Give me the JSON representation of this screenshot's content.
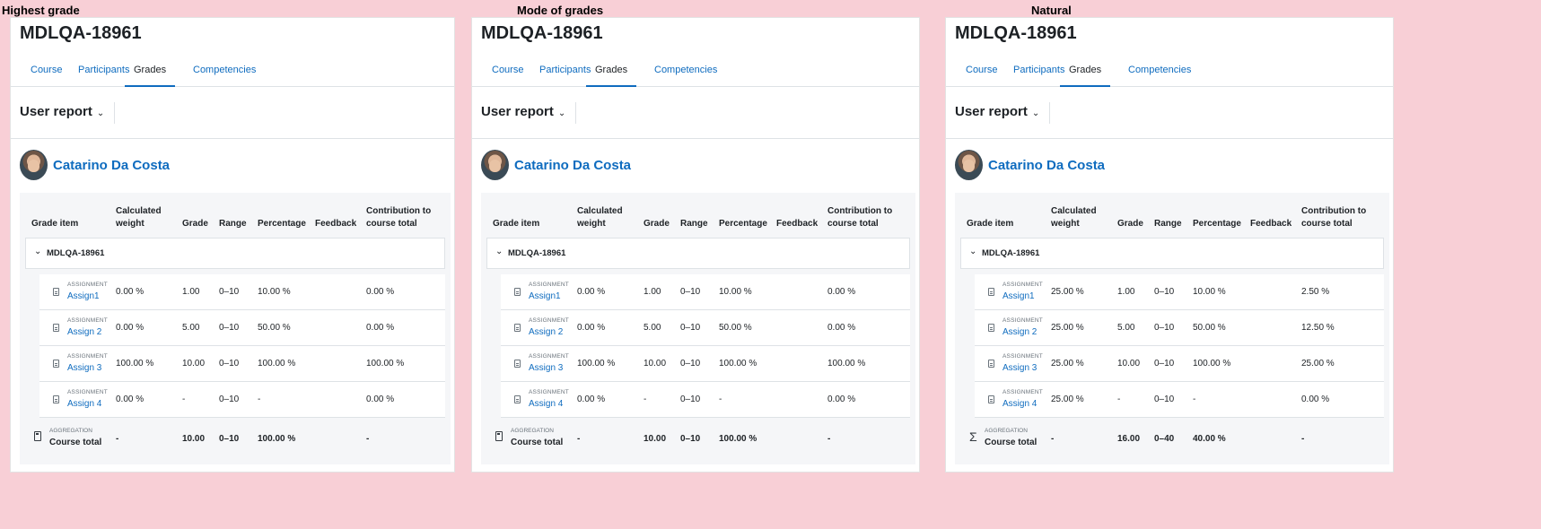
{
  "panels": [
    {
      "label": "Highest grade",
      "course": "MDLQA-18961",
      "tabs": [
        "Course",
        "Participants",
        "Grades",
        "Competencies"
      ],
      "report": "User report",
      "user": "Catarino Da Costa",
      "headers": {
        "item": "Grade item",
        "weight": "Calculated weight",
        "grade": "Grade",
        "range": "Range",
        "percentage": "Percentage",
        "feedback": "Feedback",
        "contribution": "Contribution to course total"
      },
      "category": "MDLQA-18961",
      "items": [
        {
          "type": "ASSIGNMENT",
          "name": "Assign1",
          "weight": "0.00 %",
          "grade": "1.00",
          "range": "0–10",
          "percentage": "10.00 %",
          "contribution": "0.00 %"
        },
        {
          "type": "ASSIGNMENT",
          "name": "Assign 2",
          "weight": "0.00 %",
          "grade": "5.00",
          "range": "0–10",
          "percentage": "50.00 %",
          "contribution": "0.00 %"
        },
        {
          "type": "ASSIGNMENT",
          "name": "Assign 3",
          "weight": "100.00 %",
          "grade": "10.00",
          "range": "0–10",
          "percentage": "100.00 %",
          "contribution": "100.00 %"
        },
        {
          "type": "ASSIGNMENT",
          "name": "Assign 4",
          "weight": "0.00 %",
          "grade": "-",
          "range": "0–10",
          "percentage": "-",
          "contribution": "0.00 %"
        }
      ],
      "total": {
        "type": "AGGREGATION",
        "name": "Course total",
        "icon": "calculator-icon",
        "weight": "-",
        "grade": "10.00",
        "range": "0–10",
        "percentage": "100.00 %",
        "contribution": "-"
      }
    },
    {
      "label": "Mode of grades",
      "course": "MDLQA-18961",
      "tabs": [
        "Course",
        "Participants",
        "Grades",
        "Competencies"
      ],
      "report": "User report",
      "user": "Catarino Da Costa",
      "headers": {
        "item": "Grade item",
        "weight": "Calculated weight",
        "grade": "Grade",
        "range": "Range",
        "percentage": "Percentage",
        "feedback": "Feedback",
        "contribution": "Contribution to course total"
      },
      "category": "MDLQA-18961",
      "items": [
        {
          "type": "ASSIGNMENT",
          "name": "Assign1",
          "weight": "0.00 %",
          "grade": "1.00",
          "range": "0–10",
          "percentage": "10.00 %",
          "contribution": "0.00 %"
        },
        {
          "type": "ASSIGNMENT",
          "name": "Assign 2",
          "weight": "0.00 %",
          "grade": "5.00",
          "range": "0–10",
          "percentage": "50.00 %",
          "contribution": "0.00 %"
        },
        {
          "type": "ASSIGNMENT",
          "name": "Assign 3",
          "weight": "100.00 %",
          "grade": "10.00",
          "range": "0–10",
          "percentage": "100.00 %",
          "contribution": "100.00 %"
        },
        {
          "type": "ASSIGNMENT",
          "name": "Assign 4",
          "weight": "0.00 %",
          "grade": "-",
          "range": "0–10",
          "percentage": "-",
          "contribution": "0.00 %"
        }
      ],
      "total": {
        "type": "AGGREGATION",
        "name": "Course total",
        "icon": "calculator-icon",
        "weight": "-",
        "grade": "10.00",
        "range": "0–10",
        "percentage": "100.00 %",
        "contribution": "-"
      }
    },
    {
      "label": "Natural",
      "course": "MDLQA-18961",
      "tabs": [
        "Course",
        "Participants",
        "Grades",
        "Competencies"
      ],
      "report": "User report",
      "user": "Catarino Da Costa",
      "headers": {
        "item": "Grade item",
        "weight": "Calculated weight",
        "grade": "Grade",
        "range": "Range",
        "percentage": "Percentage",
        "feedback": "Feedback",
        "contribution": "Contribution to course total"
      },
      "category": "MDLQA-18961",
      "items": [
        {
          "type": "ASSIGNMENT",
          "name": "Assign1",
          "weight": "25.00 %",
          "grade": "1.00",
          "range": "0–10",
          "percentage": "10.00 %",
          "contribution": "2.50 %"
        },
        {
          "type": "ASSIGNMENT",
          "name": "Assign 2",
          "weight": "25.00 %",
          "grade": "5.00",
          "range": "0–10",
          "percentage": "50.00 %",
          "contribution": "12.50 %"
        },
        {
          "type": "ASSIGNMENT",
          "name": "Assign 3",
          "weight": "25.00 %",
          "grade": "10.00",
          "range": "0–10",
          "percentage": "100.00 %",
          "contribution": "25.00 %"
        },
        {
          "type": "ASSIGNMENT",
          "name": "Assign 4",
          "weight": "25.00 %",
          "grade": "-",
          "range": "0–10",
          "percentage": "-",
          "contribution": "0.00 %"
        }
      ],
      "total": {
        "type": "AGGREGATION",
        "name": "Course total",
        "icon": "sigma-icon",
        "weight": "-",
        "grade": "16.00",
        "range": "0–40",
        "percentage": "40.00 %",
        "contribution": "-"
      }
    }
  ]
}
